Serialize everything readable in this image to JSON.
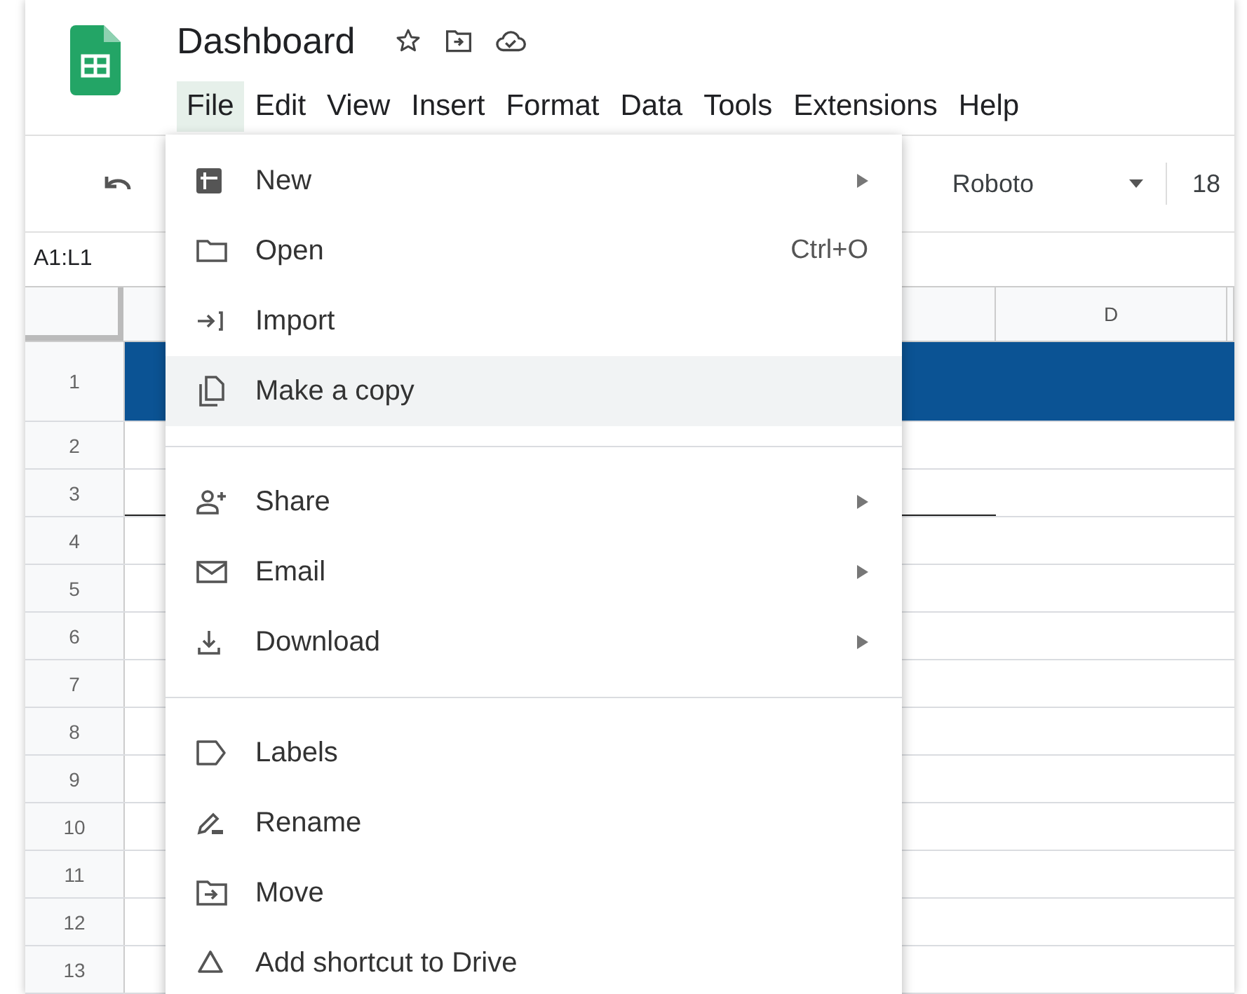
{
  "document": {
    "title": "Dashboard"
  },
  "menubar": [
    {
      "label": "File",
      "selected": true
    },
    {
      "label": "Edit",
      "selected": false
    },
    {
      "label": "View",
      "selected": false
    },
    {
      "label": "Insert",
      "selected": false
    },
    {
      "label": "Format",
      "selected": false
    },
    {
      "label": "Data",
      "selected": false
    },
    {
      "label": "Tools",
      "selected": false
    },
    {
      "label": "Extensions",
      "selected": false
    },
    {
      "label": "Help",
      "selected": false
    }
  ],
  "toolbar": {
    "font": "Roboto",
    "font_size": "18"
  },
  "name_box": "A1:L1",
  "grid": {
    "columns": [
      "D"
    ],
    "rows": [
      "1",
      "2",
      "3",
      "4",
      "5",
      "6",
      "7",
      "8",
      "9",
      "10",
      "11",
      "12",
      "13"
    ]
  },
  "file_menu": [
    {
      "kind": "item",
      "label": "New",
      "submenu": true,
      "highlighted": false
    },
    {
      "kind": "item",
      "label": "Open",
      "shortcut": "Ctrl+O",
      "submenu": false,
      "highlighted": false
    },
    {
      "kind": "item",
      "label": "Import",
      "submenu": false,
      "highlighted": false
    },
    {
      "kind": "item",
      "label": "Make a copy",
      "submenu": false,
      "highlighted": true
    },
    {
      "kind": "separator"
    },
    {
      "kind": "item",
      "label": "Share",
      "submenu": true,
      "highlighted": false
    },
    {
      "kind": "item",
      "label": "Email",
      "submenu": true,
      "highlighted": false
    },
    {
      "kind": "item",
      "label": "Download",
      "submenu": true,
      "highlighted": false
    },
    {
      "kind": "separator"
    },
    {
      "kind": "item",
      "label": "Labels",
      "submenu": false,
      "highlighted": false
    },
    {
      "kind": "item",
      "label": "Rename",
      "submenu": false,
      "highlighted": false
    },
    {
      "kind": "item",
      "label": "Move",
      "submenu": false,
      "highlighted": false
    },
    {
      "kind": "item",
      "label": "Add shortcut to Drive",
      "submenu": false,
      "highlighted": false
    }
  ]
}
